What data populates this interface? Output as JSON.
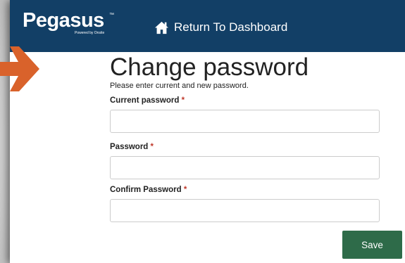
{
  "brand": {
    "name": "Pegasus",
    "trademark": "™",
    "tagline": "Powered by Onsite"
  },
  "nav": {
    "home_icon": "home-icon",
    "return_label": "Return To Dashboard"
  },
  "form": {
    "title": "Change password",
    "subtitle": "Please enter current and new password.",
    "required_marker": "*",
    "current_password_label": "Current password",
    "current_password_value": "",
    "password_label": "Password",
    "password_value": "",
    "confirm_password_label": "Confirm Password",
    "confirm_password_value": "",
    "save_label": "Save"
  },
  "colors": {
    "navbar": "#123f66",
    "save_button": "#2e6b49",
    "required": "#c0392b",
    "annotation_arrow": "#d9622b"
  }
}
